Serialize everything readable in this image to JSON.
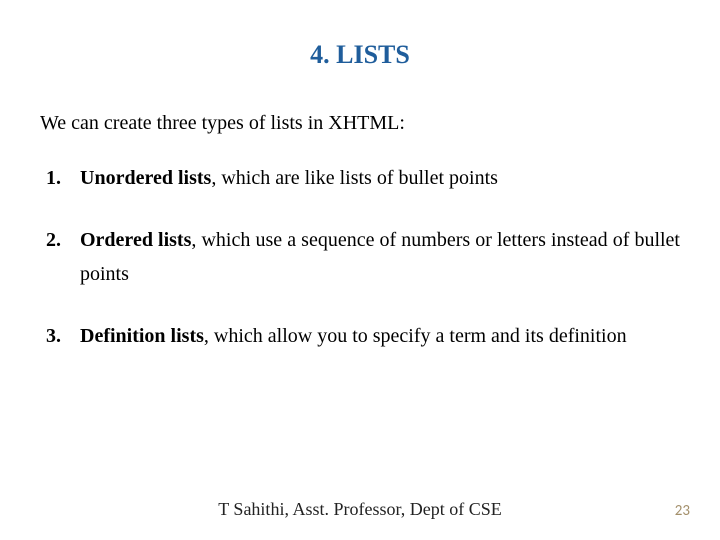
{
  "title": "4. LISTS",
  "intro": "We can create three types of lists in XHTML:",
  "items": [
    {
      "num": "1.",
      "term": "Unordered lists",
      "rest": ", which are like lists of bullet points"
    },
    {
      "num": "2.",
      "term": "Ordered lists",
      "rest": ", which use a sequence of numbers or letters instead of bullet points"
    },
    {
      "num": "3.",
      "term": "Definition lists",
      "rest": ", which allow you to specify a term and its definition"
    }
  ],
  "footer": "T Sahithi, Asst. Professor, Dept of CSE",
  "page": "23"
}
